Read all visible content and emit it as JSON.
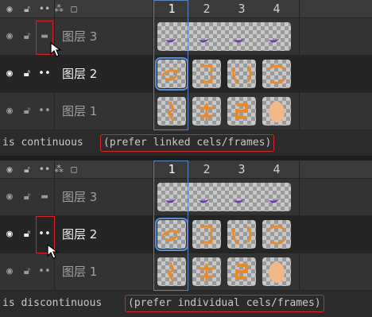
{
  "header_icons": [
    "eye-icon",
    "lock-icon",
    "link-icon",
    "tag-icon",
    "square-icon"
  ],
  "frames": [
    "1",
    "2",
    "3",
    "4"
  ],
  "layers": [
    {
      "name": "图层 3",
      "cel_kind": "continuous-purple-moon"
    },
    {
      "name": "图层 2",
      "cel_kind": "orange-arrows"
    },
    {
      "name": "图层 1",
      "cel_kind": "orange-blob"
    }
  ],
  "panel1": {
    "status_prefix": "is continuous ",
    "status_hint": "(prefer linked cels/frames)"
  },
  "panel2": {
    "status_prefix": "is discontinuous ",
    "status_hint": "(prefer individual cels/frames)"
  },
  "colors": {
    "accent_blue": "#5a85c0",
    "highlight_red": "#d9232a",
    "cel_orange": "#e88a2a",
    "cel_purple": "#6a3aa8"
  }
}
